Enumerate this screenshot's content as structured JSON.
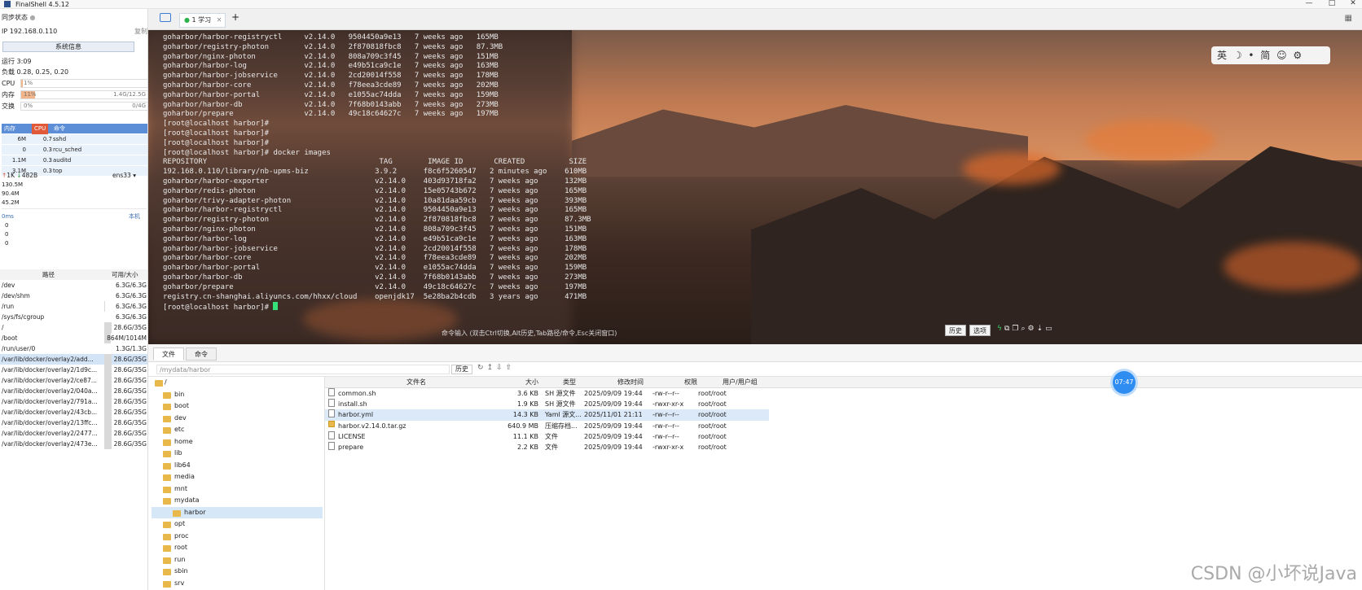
{
  "window": {
    "title": "FinalShell 4.5.12"
  },
  "sidebar": {
    "sync_label": "同步状态",
    "ip": "IP  192.168.0.110",
    "copy": "复制",
    "sysinfo_button": "系统信息",
    "uptime": "运行 3:09",
    "load": "负载 0.28, 0.25, 0.20",
    "cpu": {
      "label": "CPU",
      "text": "1%",
      "level": 0.01
    },
    "mem": {
      "label": "内存",
      "text": "11%",
      "right": "1.4G/12.5G",
      "level": 0.11
    },
    "swap": {
      "label": "交换",
      "text": "0%",
      "right": "0/4G",
      "level": 0
    },
    "proc_header": [
      "内存",
      "CPU",
      "命令"
    ],
    "procs": [
      {
        "mem": "6M",
        "cpu": "0.7",
        "cmd": "sshd"
      },
      {
        "mem": "0",
        "cpu": "0.3",
        "cmd": "rcu_sched"
      },
      {
        "mem": "1.1M",
        "cpu": "0.3",
        "cmd": "auditd"
      },
      {
        "mem": "3.1M",
        "cpu": "0.3",
        "cmd": "top"
      }
    ],
    "net": {
      "up": "1K",
      "down": "482B",
      "iface": "ens33",
      "y1": "130.5M",
      "y2": "90.4M",
      "y3": "45.2M"
    },
    "ping": {
      "ms": "0ms",
      "host": "本机",
      "v1": "0",
      "v2": "0",
      "v3": "0"
    },
    "disk_header": [
      "路径",
      "可用/大小"
    ],
    "disks": [
      {
        "path": "/dev",
        "size": "6.3G/6.3G",
        "level": 0.0
      },
      {
        "path": "/dev/shm",
        "size": "6.3G/6.3G",
        "level": 0.0
      },
      {
        "path": "/run",
        "size": "6.3G/6.3G",
        "level": 0.02
      },
      {
        "path": "/sys/fs/cgroup",
        "size": "6.3G/6.3G",
        "level": 0.0
      },
      {
        "path": "/",
        "size": "28.6G/35G",
        "level": 0.18
      },
      {
        "path": "/boot",
        "size": "864M/1014M",
        "level": 0.15
      },
      {
        "path": "/run/user/0",
        "size": "1.3G/1.3G",
        "level": 0.0
      },
      {
        "path": "/var/lib/docker/overlay2/add...",
        "size": "28.6G/35G",
        "level": 0.18
      },
      {
        "path": "/var/lib/docker/overlay2/1d9c...",
        "size": "28.6G/35G",
        "level": 0.18
      },
      {
        "path": "/var/lib/docker/overlay2/ce87...",
        "size": "28.6G/35G",
        "level": 0.18
      },
      {
        "path": "/var/lib/docker/overlay2/040a...",
        "size": "28.6G/35G",
        "level": 0.18
      },
      {
        "path": "/var/lib/docker/overlay2/791a...",
        "size": "28.6G/35G",
        "level": 0.18
      },
      {
        "path": "/var/lib/docker/overlay2/43cb...",
        "size": "28.6G/35G",
        "level": 0.18
      },
      {
        "path": "/var/lib/docker/overlay2/13ffc...",
        "size": "28.6G/35G",
        "level": 0.18
      },
      {
        "path": "/var/lib/docker/overlay2/2477...",
        "size": "28.6G/35G",
        "level": 0.18
      },
      {
        "path": "/var/lib/docker/overlay2/473e...",
        "size": "28.6G/35G",
        "level": 0.18
      }
    ]
  },
  "tabs": {
    "session": "1 学习",
    "add": "+"
  },
  "terminal": {
    "lines": [
      "goharbor/harbor-registryctl     v2.14.0   9504450a9e13   7 weeks ago   165MB",
      "goharbor/registry-photon        v2.14.0   2f870818fbc8   7 weeks ago   87.3MB",
      "goharbor/nginx-photon           v2.14.0   808a709c3f45   7 weeks ago   151MB",
      "goharbor/harbor-log             v2.14.0   e49b51ca9c1e   7 weeks ago   163MB",
      "goharbor/harbor-jobservice      v2.14.0   2cd20014f558   7 weeks ago   178MB",
      "goharbor/harbor-core            v2.14.0   f78eea3cde89   7 weeks ago   202MB",
      "goharbor/harbor-portal          v2.14.0   e1055ac74dda   7 weeks ago   159MB",
      "goharbor/harbor-db              v2.14.0   7f68b0143abb   7 weeks ago   273MB",
      "goharbor/prepare                v2.14.0   49c18c64627c   7 weeks ago   197MB",
      "[root@localhost harbor]#",
      "[root@localhost harbor]#",
      "[root@localhost harbor]#",
      "[root@localhost harbor]# docker images",
      "REPOSITORY                                       TAG        IMAGE ID       CREATED          SIZE",
      "192.168.0.110/library/nb-upms-biz               3.9.2      f8c6f5260547   2 minutes ago    610MB",
      "goharbor/harbor-exporter                        v2.14.0    403d93718fa2   7 weeks ago      132MB",
      "goharbor/redis-photon                           v2.14.0    15e05743b672   7 weeks ago      165MB",
      "goharbor/trivy-adapter-photon                   v2.14.0    10a81daa59cb   7 weeks ago      393MB",
      "goharbor/harbor-registryctl                     v2.14.0    9504450a9e13   7 weeks ago      165MB",
      "goharbor/registry-photon                        v2.14.0    2f870818fbc8   7 weeks ago      87.3MB",
      "goharbor/nginx-photon                           v2.14.0    808a709c3f45   7 weeks ago      151MB",
      "goharbor/harbor-log                             v2.14.0    e49b51ca9c1e   7 weeks ago      163MB",
      "goharbor/harbor-jobservice                      v2.14.0    2cd20014f558   7 weeks ago      178MB",
      "goharbor/harbor-core                            v2.14.0    f78eea3cde89   7 weeks ago      202MB",
      "goharbor/harbor-portal                          v2.14.0    e1055ac74dda   7 weeks ago      159MB",
      "goharbor/harbor-db                              v2.14.0    7f68b0143abb   7 weeks ago      273MB",
      "goharbor/prepare                                v2.14.0    49c18c64627c   7 weeks ago      197MB",
      "registry.cn-shanghai.aliyuncs.com/hhxx/cloud    openjdk17  5e28ba2b4cdb   3 years ago      471MB"
    ],
    "prompt": "[root@localhost harbor]# ",
    "hint": "命令输入 (双击Ctrl切换,Alt历史,Tab路径/命令,Esc关闭窗口)",
    "history_btn": "历史",
    "options_btn": "选项"
  },
  "ime": {
    "text": "英 ☽ • 简 ☺ ⚙"
  },
  "clock": "07:47",
  "filepanel": {
    "tabs": [
      "文件",
      "命令"
    ],
    "path": "/mydata/harbor",
    "history_btn": "历史",
    "tree": [
      {
        "name": "/",
        "level": 0
      },
      {
        "name": "bin",
        "level": 1
      },
      {
        "name": "boot",
        "level": 1
      },
      {
        "name": "dev",
        "level": 1
      },
      {
        "name": "etc",
        "level": 1
      },
      {
        "name": "home",
        "level": 1
      },
      {
        "name": "lib",
        "level": 1
      },
      {
        "name": "lib64",
        "level": 1
      },
      {
        "name": "media",
        "level": 1
      },
      {
        "name": "mnt",
        "level": 1
      },
      {
        "name": "mydata",
        "level": 1
      },
      {
        "name": "harbor",
        "level": 2
      },
      {
        "name": "opt",
        "level": 1
      },
      {
        "name": "proc",
        "level": 1
      },
      {
        "name": "root",
        "level": 1
      },
      {
        "name": "run",
        "level": 1
      },
      {
        "name": "sbin",
        "level": 1
      },
      {
        "name": "srv",
        "level": 1
      }
    ],
    "columns": [
      "文件名",
      "大小",
      "类型",
      "修改时间",
      "权限",
      "用户/用户组"
    ],
    "files": [
      {
        "name": "common.sh",
        "size": "3.6 KB",
        "type": "SH 源文件",
        "mtime": "2025/09/09 19:44",
        "perm": "-rw-r--r--",
        "owner": "root/root",
        "folder": false
      },
      {
        "name": "install.sh",
        "size": "1.9 KB",
        "type": "SH 源文件",
        "mtime": "2025/09/09 19:44",
        "perm": "-rwxr-xr-x",
        "owner": "root/root",
        "folder": false
      },
      {
        "name": "harbor.yml",
        "size": "14.3 KB",
        "type": "Yaml 源文...",
        "mtime": "2025/11/01 21:11",
        "perm": "-rw-r--r--",
        "owner": "root/root",
        "folder": false
      },
      {
        "name": "harbor.v2.14.0.tar.gz",
        "size": "640.9 MB",
        "type": "压缩存档...",
        "mtime": "2025/09/09 19:44",
        "perm": "-rw-r--r--",
        "owner": "root/root",
        "folder": true
      },
      {
        "name": "LICENSE",
        "size": "11.1 KB",
        "type": "文件",
        "mtime": "2025/09/09 19:44",
        "perm": "-rw-r--r--",
        "owner": "root/root",
        "folder": false
      },
      {
        "name": "prepare",
        "size": "2.2 KB",
        "type": "文件",
        "mtime": "2025/09/09 19:44",
        "perm": "-rwxr-xr-x",
        "owner": "root/root",
        "folder": false
      }
    ]
  },
  "watermark": "CSDN @小坏说Java"
}
